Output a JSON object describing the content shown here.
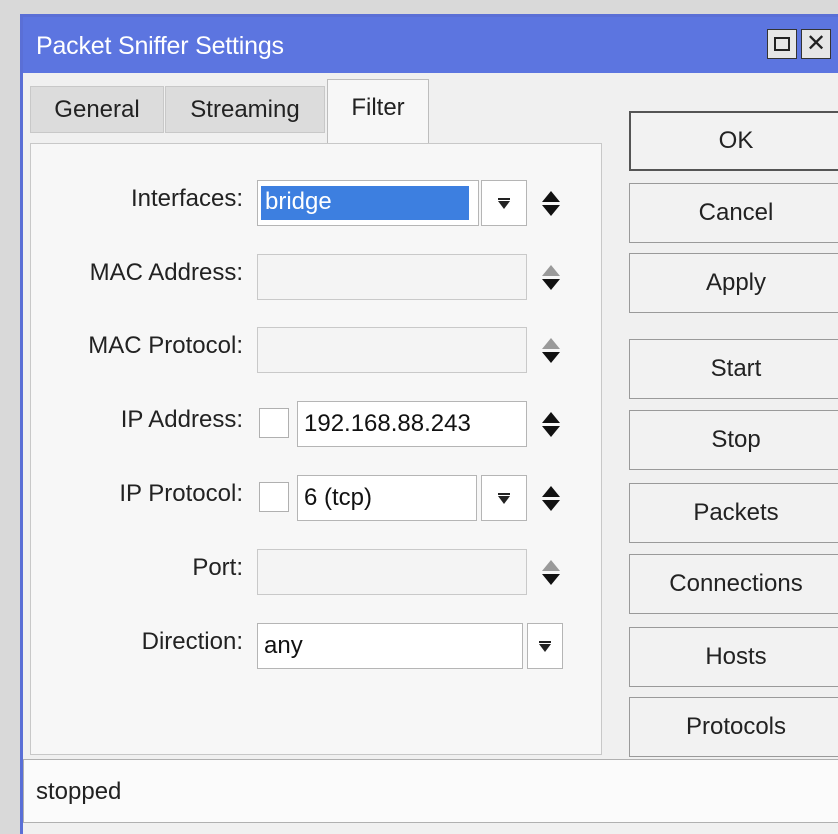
{
  "window": {
    "title": "Packet Sniffer Settings"
  },
  "tabs": [
    "General",
    "Streaming",
    "Filter"
  ],
  "active_tab": "Filter",
  "form": {
    "interfaces": {
      "label": "Interfaces:",
      "value": "bridge"
    },
    "mac_address": {
      "label": "MAC Address:",
      "value": ""
    },
    "mac_protocol": {
      "label": "MAC Protocol:",
      "value": ""
    },
    "ip_address": {
      "label": "IP Address:",
      "value": "192.168.88.243"
    },
    "ip_protocol": {
      "label": "IP Protocol:",
      "value": "6 (tcp)"
    },
    "port": {
      "label": "Port:",
      "value": ""
    },
    "direction": {
      "label": "Direction:",
      "value": "any"
    }
  },
  "buttons": {
    "ok": "OK",
    "cancel": "Cancel",
    "apply": "Apply",
    "start": "Start",
    "stop": "Stop",
    "packets": "Packets",
    "connections": "Connections",
    "hosts": "Hosts",
    "protocols": "Protocols"
  },
  "status": "stopped",
  "colors": {
    "titlebar": "#5c75e0",
    "selection": "#3d7fe0"
  }
}
